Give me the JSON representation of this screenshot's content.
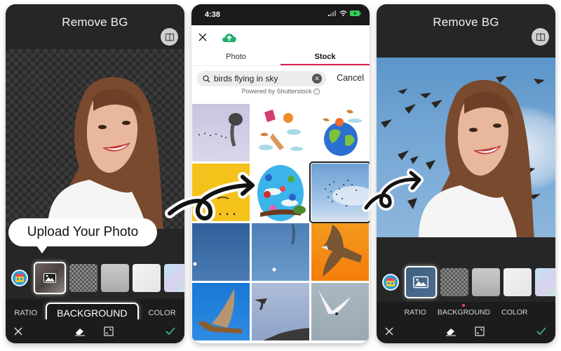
{
  "left_phone": {
    "title": "Remove BG",
    "callout": "Upload Your Photo",
    "tabs": [
      {
        "label": "RATIO",
        "highlighted": false
      },
      {
        "label": "BACKGROUND",
        "highlighted": true
      },
      {
        "label": "COLOR",
        "highlighted": false
      }
    ],
    "thumbnails": [
      "uploaded-photo",
      "transparent",
      "concrete",
      "marble",
      "pastel"
    ],
    "actions": [
      "close",
      "eraser",
      "crop",
      "confirm"
    ]
  },
  "middle_phone": {
    "status_time": "4:38",
    "tabs": [
      {
        "label": "Photo",
        "active": false
      },
      {
        "label": "Stock",
        "active": true
      }
    ],
    "search": {
      "value": "birds flying in sky",
      "cancel_label": "Cancel"
    },
    "powered_by": "Powered by Shutterstock",
    "results": [
      {
        "name": "starling-murmuration",
        "selected": false
      },
      {
        "name": "kite-birds-illustration",
        "selected": false
      },
      {
        "name": "globe-birds-illustration",
        "selected": false
      },
      {
        "name": "birds-yellow-background",
        "selected": false
      },
      {
        "name": "cartoon-birds-oval",
        "selected": false
      },
      {
        "name": "flock-blue-sky",
        "selected": true
      },
      {
        "name": "blue-sky-moon",
        "selected": false
      },
      {
        "name": "blue-sky-flock-moon",
        "selected": false
      },
      {
        "name": "hawk-orange-sky",
        "selected": false
      },
      {
        "name": "falcon-blue-sky",
        "selected": false
      },
      {
        "name": "gull-over-hill",
        "selected": false
      },
      {
        "name": "tern-grey-sky",
        "selected": false
      }
    ]
  },
  "right_phone": {
    "title": "Remove BG",
    "tabs": [
      {
        "label": "RATIO",
        "active": false
      },
      {
        "label": "BACKGROUND",
        "active": true
      },
      {
        "label": "COLOR",
        "active": false
      }
    ],
    "thumbnails": [
      "sky-photo",
      "transparent",
      "concrete",
      "marble",
      "pastel"
    ],
    "actions": [
      "close",
      "eraser",
      "crop",
      "confirm"
    ]
  },
  "colors": {
    "accent_pink": "#d4244f",
    "confirm_green": "#3ec28f",
    "upload_green": "#1fae6b"
  }
}
